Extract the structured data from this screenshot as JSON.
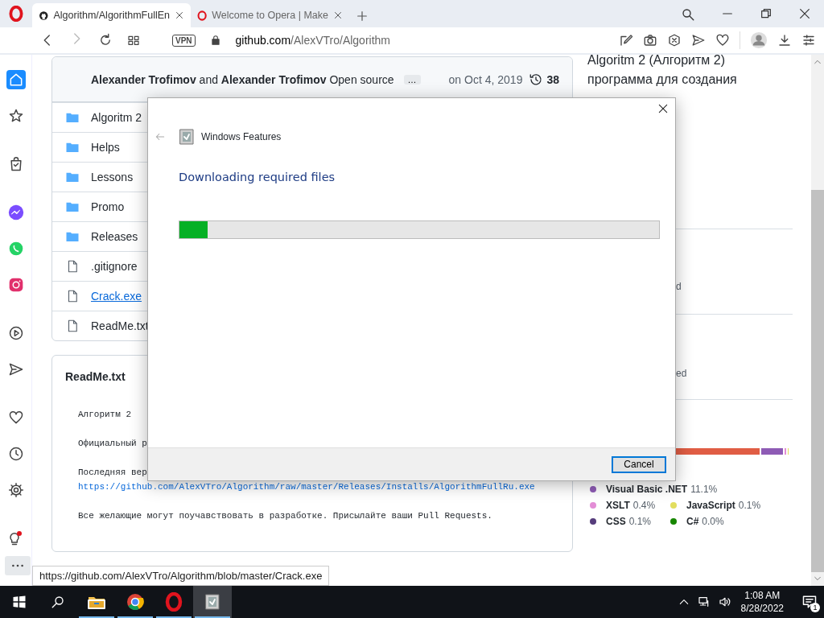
{
  "browser": {
    "tabs": [
      {
        "title": "Algorithm/AlgorithmFullEn",
        "kind": "github",
        "selected": true
      },
      {
        "title": "Welcome to Opera | Make",
        "kind": "opera",
        "selected": false
      }
    ],
    "address": {
      "vpn": "VPN",
      "host": "github.com",
      "path": "/AlexVTro/Algorithm"
    }
  },
  "sidebar": {
    "groups": [
      [
        {
          "kind": "home",
          "selected": true,
          "alert": false
        },
        {
          "kind": "star",
          "selected": false,
          "alert": false
        }
      ],
      [
        {
          "kind": "bag",
          "selected": false,
          "alert": false
        }
      ],
      [
        {
          "kind": "messenger",
          "selected": false,
          "alert": false
        },
        {
          "kind": "whatsapp",
          "selected": false,
          "alert": false
        },
        {
          "kind": "instagram",
          "selected": false,
          "alert": false
        }
      ],
      [
        {
          "kind": "play",
          "selected": false,
          "alert": false
        },
        {
          "kind": "send",
          "selected": false,
          "alert": false
        }
      ],
      [
        {
          "kind": "heart",
          "selected": false,
          "alert": false
        },
        {
          "kind": "clock",
          "selected": false,
          "alert": false
        },
        {
          "kind": "settings",
          "selected": false,
          "alert": false
        }
      ],
      [
        {
          "kind": "tips",
          "selected": false,
          "alert": true
        },
        {
          "kind": "more",
          "selected": false,
          "alert": false
        }
      ]
    ]
  },
  "commit": {
    "authors": "**Alexander Trofimov** and **Alexander Trofimov** Open source",
    "more": "…",
    "date": "on Oct 4, 2019",
    "commits": "38"
  },
  "files": [
    {
      "name": "Algoritm 2",
      "kind": "folder",
      "hovered": false
    },
    {
      "name": "Helps",
      "kind": "folder",
      "hovered": false
    },
    {
      "name": "Lessons",
      "kind": "folder",
      "hovered": false
    },
    {
      "name": "Promo",
      "kind": "folder",
      "hovered": false
    },
    {
      "name": "Releases",
      "kind": "folder",
      "hovered": false
    },
    {
      "name": ".gitignore",
      "kind": "file",
      "hovered": false
    },
    {
      "name": "Crack.exe",
      "kind": "file",
      "hovered": true
    },
    {
      "name": "ReadMe.txt",
      "kind": "file",
      "hovered": false
    }
  ],
  "readme": {
    "title": "ReadMe.txt",
    "lines": [
      {
        "kind": "text",
        "text": "Алгоритм 2"
      },
      {
        "kind": "text",
        "text": "Официальный р"
      },
      {
        "kind": "text",
        "text": "Последняя вер"
      },
      {
        "kind": "link",
        "text": "https://github.com/AlexVTro/Algorithm/raw/master/Releases/Installs/AlgorithmFullRu.exe"
      },
      {
        "kind": "text",
        "text": "Все желающие могут поучавствовать в разработке. Присылайте ваши Pull Requests."
      }
    ]
  },
  "about": {
    "description": "Algoritm 2 (Алгоритм 2) программа для создания",
    "fragments": [
      "d",
      "ed"
    ]
  },
  "languages": [
    {
      "name": "Visual Basic .NET",
      "percent": "11.1%",
      "color": "#8e5bb5"
    },
    {
      "name": "XSLT",
      "percent": "0.4%",
      "color": "#e38dd6"
    },
    {
      "name": "JavaScript",
      "percent": "0.1%",
      "color": "#e2de5e"
    },
    {
      "name": "CSS",
      "percent": "0.1%",
      "color": "#563d7c"
    },
    {
      "name": "C#",
      "percent": "0.0%",
      "color": "#178600"
    }
  ],
  "status_link": "https://github.com/AlexVTro/Algorithm/blob/master/Crack.exe",
  "dialog": {
    "title": "Windows Features",
    "heading": "Downloading required files",
    "progress": {
      "level": 0.058
    },
    "buttons": [
      "Cancel"
    ]
  },
  "taskbar": {
    "apps": [
      {
        "kind": "explorer",
        "running": true,
        "selected": false
      },
      {
        "kind": "chrome",
        "running": true,
        "selected": false
      },
      {
        "kind": "opera",
        "running": true,
        "selected": false
      },
      {
        "kind": "features",
        "running": true,
        "selected": true
      }
    ],
    "time": "1:08 AM",
    "date": "8/28/2022",
    "notifications": "1"
  }
}
